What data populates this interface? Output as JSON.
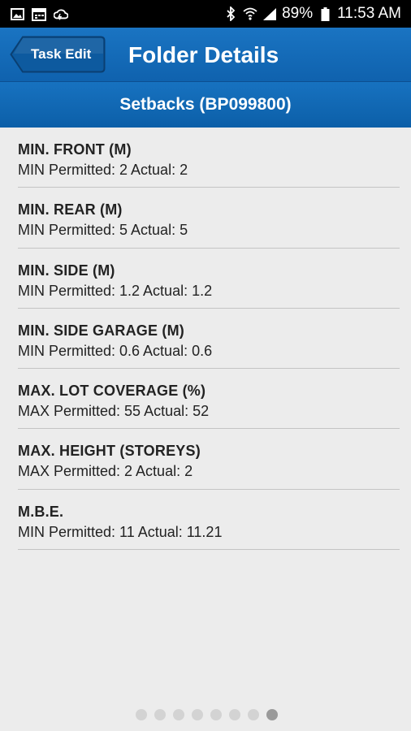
{
  "status_bar": {
    "battery": "89%",
    "time": "11:53 AM"
  },
  "header": {
    "back_label": "Task Edit",
    "title": "Folder Details",
    "color": "#1a6bb8"
  },
  "subheader": {
    "title": "Setbacks (BP099800)"
  },
  "items": [
    {
      "title": "MIN. FRONT (M)",
      "values": "MIN Permitted: 2 Actual: 2"
    },
    {
      "title": "MIN. REAR (M)",
      "values": "MIN Permitted: 5 Actual: 5"
    },
    {
      "title": "MIN. SIDE (M)",
      "values": "MIN Permitted: 1.2 Actual: 1.2"
    },
    {
      "title": "MIN. SIDE GARAGE (M)",
      "values": "MIN Permitted: 0.6 Actual: 0.6"
    },
    {
      "title": "MAX. LOT COVERAGE (%)",
      "values": "MAX Permitted: 55 Actual: 52"
    },
    {
      "title": "MAX. HEIGHT (STOREYS)",
      "values": "MAX Permitted: 2 Actual: 2"
    },
    {
      "title": "M.B.E.",
      "values": "MIN Permitted: 11 Actual: 11.21"
    }
  ],
  "pager": {
    "page_count": 8,
    "active_page": 8
  }
}
